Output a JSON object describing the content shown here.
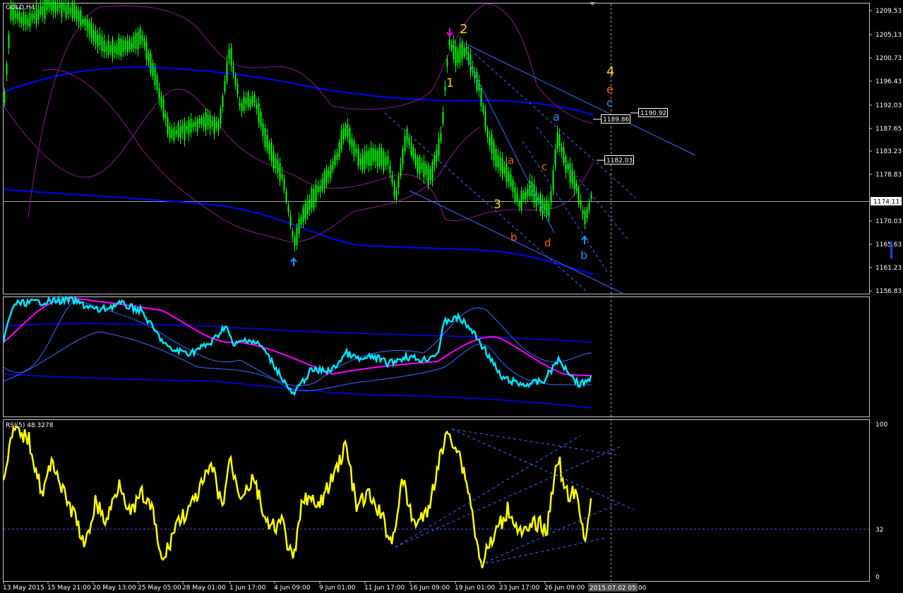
{
  "symbol_label": "GOLD,H4",
  "rsi_label": "RSI(5) 48.3278",
  "colors": {
    "background": "#000000",
    "panel_border": "#c8c8c8",
    "candles": "#00ff00",
    "bollinger": "#8b1a8b",
    "ma_blue": "#0000ff",
    "channel_lines": "#3a6bff",
    "rsi": "#ffff00",
    "indicator_cyan": "#00e5ff",
    "indicator_magenta": "#ff00ff",
    "wave_yellow": "#ffd400",
    "wave_orange": "#ff5a1a",
    "wave_blue": "#1e90ff"
  },
  "price_axis": [
    "1209.53",
    "1205.13",
    "1200.73",
    "1196.43",
    "1192.03",
    "1187.65",
    "1183.23",
    "1178.83",
    "1174.11",
    "1170.03",
    "1165.63",
    "1161.23",
    "1156.83"
  ],
  "price_tags": {
    "current": "1174.11",
    "t1": "1190.92",
    "t2": "1189.86",
    "t3": "1182.03"
  },
  "rsi_axis": [
    "100",
    "32",
    "0"
  ],
  "time_axis": [
    "13 May 2015",
    "15 May 21:00",
    "20 May 13:00",
    "25 May 05:00",
    "28 May 01:00",
    "1 Jun 17:00",
    "4 Jun 09:00",
    "9 Jun 01:00",
    "11 Jun 17:00",
    "16 Jun 09:00",
    "19 Jun 01:00",
    "23 Jun 17:00",
    "26 Jun 09:00"
  ],
  "time_cursor": "2015.07.02 05:00",
  "wave_labels": {
    "w2": "2",
    "w1": "1",
    "w3": "3",
    "w4": "4",
    "e": "e",
    "c_blue": "c",
    "a_blue": "a",
    "b_blue": "b",
    "a_or": "a",
    "b_or": "b",
    "c_or": "c",
    "d_or": "d"
  },
  "icons": {
    "sell_arrow": "down-arrow-icon",
    "buy_arrow": "up-arrow-icon"
  }
}
